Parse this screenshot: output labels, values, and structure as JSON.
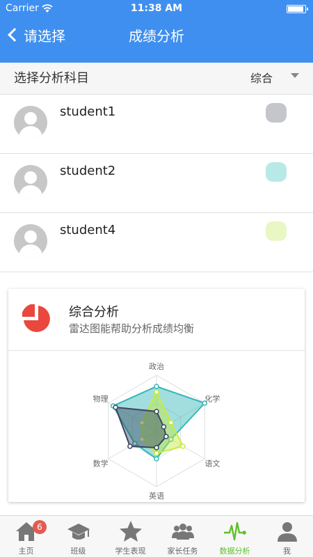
{
  "status_bar": {
    "carrier": "Carrier",
    "time": "11:38 AM"
  },
  "nav": {
    "back_label": "请选择",
    "title": "成绩分析"
  },
  "subject": {
    "label": "选择分析科目",
    "value": "综合"
  },
  "students": [
    {
      "name": "student1",
      "color": "#c4c6cb"
    },
    {
      "name": "student2",
      "color": "#b7e9e7"
    },
    {
      "name": "student4",
      "color": "#e8f7c3"
    }
  ],
  "card": {
    "title": "综合分析",
    "subtitle": "雷达图能帮助分析成绩均衡",
    "radar": {
      "axes": [
        "政治",
        "化学",
        "语文",
        "英语",
        "数学",
        "物理"
      ],
      "max": 100,
      "series": [
        {
          "color": "#34b6b8",
          "values": [
            80,
            100,
            30,
            50,
            45,
            90
          ]
        },
        {
          "color": "#c6ec3a",
          "values": [
            70,
            30,
            55,
            40,
            30,
            30
          ]
        },
        {
          "color": "#3a4660",
          "values": [
            35,
            15,
            20,
            30,
            55,
            85
          ]
        }
      ]
    }
  },
  "tabs": [
    {
      "label": "主页",
      "icon": "home-icon",
      "badge": "6"
    },
    {
      "label": "班级",
      "icon": "graduation-cap-icon"
    },
    {
      "label": "学生表现",
      "icon": "star-icon"
    },
    {
      "label": "家长任务",
      "icon": "group-icon"
    },
    {
      "label": "数据分析",
      "icon": "pulse-icon",
      "active": true
    },
    {
      "label": "我",
      "icon": "person-icon"
    }
  ]
}
